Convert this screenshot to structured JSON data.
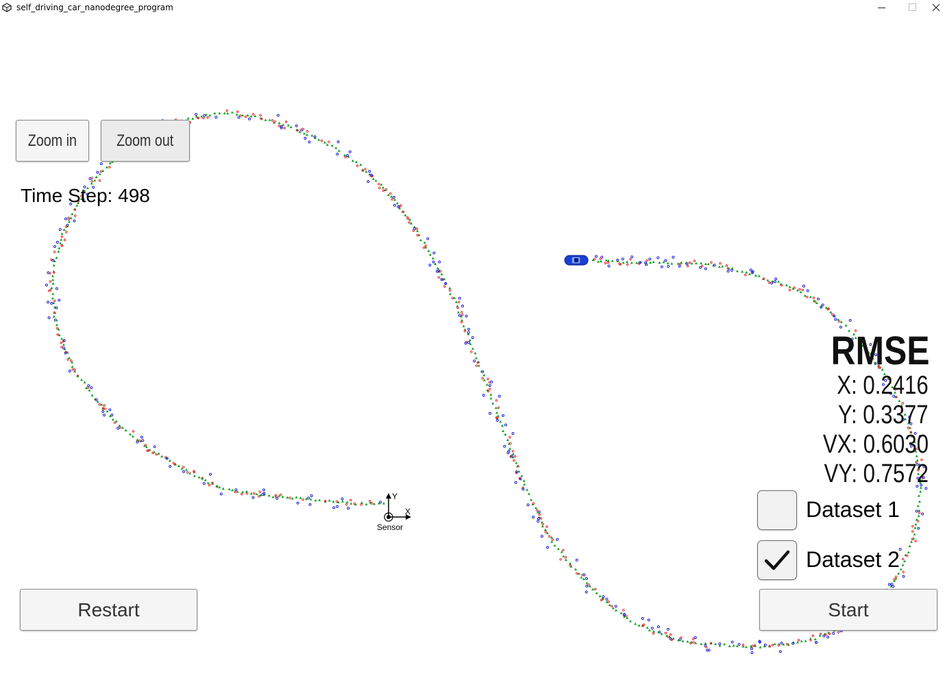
{
  "window": {
    "title": "self_driving_car_nanodegree_program"
  },
  "controls": {
    "zoom_in_label": "Zoom in",
    "zoom_out_label": "Zoom out",
    "restart_label": "Restart",
    "start_label": "Start"
  },
  "status": {
    "time_step_label": "Time Step:",
    "time_step_value": "498"
  },
  "rmse": {
    "title": "RMSE",
    "x": "X: 0.2416",
    "y": "Y: 0.3377",
    "vx": "VX: 0.6030",
    "vy": "VY: 0.7572"
  },
  "datasets": [
    {
      "label": "Dataset 1",
      "checked": false
    },
    {
      "label": "Dataset 2",
      "checked": true
    }
  ],
  "sensor": {
    "label": "Sensor",
    "axis_x": "X",
    "axis_y": "Y"
  },
  "colors": {
    "lidar": "#e02020",
    "radar": "#2020d0",
    "estimate": "#10a020",
    "car": "#1a3fd8"
  }
}
